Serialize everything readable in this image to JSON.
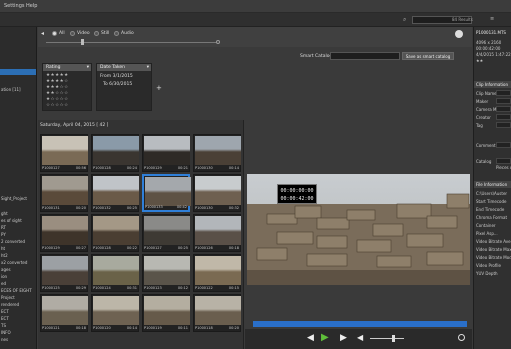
{
  "menubar": {
    "items": [
      "Settings",
      "Help"
    ]
  },
  "search": {
    "results_label": "84 Results"
  },
  "sidebar": {
    "items": [
      {
        "label": "",
        "selected": true
      },
      {
        "label": "ation [11]",
        "selected": false
      },
      {
        "label": "Sight_Project",
        "selected": false
      },
      {
        "label": "ght",
        "selected": false
      },
      {
        "label": "es of sight",
        "selected": false
      },
      {
        "label": "RT",
        "selected": false
      },
      {
        "label": "PY",
        "selected": false
      },
      {
        "label": "2 converted",
        "selected": false
      },
      {
        "label": "ht",
        "selected": false
      },
      {
        "label": "ht2",
        "selected": false
      },
      {
        "label": "x2 converted",
        "selected": false
      },
      {
        "label": "ages",
        "selected": false
      },
      {
        "label": "ion",
        "selected": false
      },
      {
        "label": "ed",
        "selected": false
      },
      {
        "label": "ECES OF EIGHT",
        "selected": false
      },
      {
        "label": "Project",
        "selected": false
      },
      {
        "label": "rendered",
        "selected": false
      },
      {
        "label": "ECT",
        "selected": false
      },
      {
        "label": "ECT",
        "selected": false
      },
      {
        "label": "TS",
        "selected": false
      },
      {
        "label": "INFO",
        "selected": false
      },
      {
        "label": "nes",
        "selected": false
      }
    ]
  },
  "filterbar": {
    "radios": [
      {
        "label": "All",
        "on": true
      },
      {
        "label": "Video",
        "on": false
      },
      {
        "label": "Still",
        "on": false
      },
      {
        "label": "Audio",
        "on": false
      }
    ]
  },
  "filters": {
    "rating": {
      "title": "Rating",
      "rows": [
        "★★★★★",
        "★★★★☆",
        "★★★☆☆",
        "★★☆☆☆",
        "★☆☆☆☆",
        "☆☆☆☆☆"
      ]
    },
    "date": {
      "title": "Date Taken",
      "from": "From 3/1/2015",
      "to": "To 6/30/2015"
    },
    "smart_catalog_label": "Smart Catalog",
    "save_label": "Save as smart catalog",
    "add_symbol": "+"
  },
  "grid": {
    "date_header": "Saturday, April 04, 2015 [ 42 ]",
    "thumbs": [
      {
        "name": "P1000127",
        "tc": "00:56",
        "colors": [
          "#c8c2b6",
          "#7a6a55"
        ]
      },
      {
        "name": "P1000128",
        "tc": "00:24",
        "colors": [
          "#8a9aa8",
          "#3a3530"
        ]
      },
      {
        "name": "P1000129",
        "tc": "00:21",
        "colors": [
          "#b8bcc0",
          "#2e2a26"
        ]
      },
      {
        "name": "P1000130",
        "tc": "00:14",
        "colors": [
          "#9ea6ae",
          "#4a4036"
        ]
      },
      {
        "name": "P1000131",
        "tc": "00:20",
        "colors": [
          "#a09a90",
          "#5a4a3a"
        ]
      },
      {
        "name": "P1000132",
        "tc": "00:25",
        "colors": [
          "#c0c4c8",
          "#6a5a48"
        ]
      },
      {
        "name": "P1000133",
        "tc": "00:42",
        "colors": [
          "#a4a8ac",
          "#5e5244"
        ],
        "selected": true
      },
      {
        "name": "P1000130",
        "tc": "00:32",
        "colors": [
          "#c8ccce",
          "#6e6050"
        ]
      },
      {
        "name": "P1000129",
        "tc": "00:27",
        "colors": [
          "#9a8e80",
          "#3e342a"
        ]
      },
      {
        "name": "P1000128",
        "tc": "00:22",
        "colors": [
          "#a49886",
          "#4a3e32"
        ]
      },
      {
        "name": "P1000127",
        "tc": "00:25",
        "colors": [
          "#8a8a88",
          "#3e3a34"
        ]
      },
      {
        "name": "P1000126",
        "tc": "00:18",
        "colors": [
          "#b2b6ba",
          "#5a5048"
        ]
      },
      {
        "name": "P1000125",
        "tc": "00:29",
        "colors": [
          "#9ca0a4",
          "#4a4038"
        ]
      },
      {
        "name": "P1000124",
        "tc": "00:31",
        "colors": [
          "#a8aa9e",
          "#6a6248"
        ]
      },
      {
        "name": "P1000123",
        "tc": "00:12",
        "colors": [
          "#b8b8b2",
          "#5a544a"
        ]
      },
      {
        "name": "P1000122",
        "tc": "00:15",
        "colors": [
          "#c0b8a8",
          "#7a6a52"
        ]
      },
      {
        "name": "P1000121",
        "tc": "00:18",
        "colors": [
          "#b0aca4",
          "#6a6050"
        ]
      },
      {
        "name": "P1000120",
        "tc": "00:14",
        "colors": [
          "#bcb6a8",
          "#6e6252"
        ]
      },
      {
        "name": "P1000119",
        "tc": "00:11",
        "colors": [
          "#b4aea0",
          "#665a4a"
        ]
      },
      {
        "name": "P1000118",
        "tc": "00:20",
        "colors": [
          "#b8b2a6",
          "#6a5e4e"
        ]
      }
    ]
  },
  "viewer": {
    "timecode_top": "00:00:00:00",
    "timecode_bottom": "00:00:42:00"
  },
  "rpanel": {
    "title": "P1000131.MTS",
    "dims": "4096 x 2160",
    "time": "00:00:42:00",
    "date": "4/4/2015 1:47:22 PM",
    "sections": {
      "clip_info": "Clip Information",
      "file_info": "File Information"
    },
    "fields": [
      "Clip Name",
      "Maker",
      "Camera Model",
      "Creator",
      "Tag",
      "Comment",
      "Catalog"
    ],
    "file_fields": [
      "C:\\Users\\Auster",
      "Start Timecode",
      "End Timecode",
      "Chroma Format",
      "Container",
      "Pixel Asp...",
      "Video Bitrate Avera...",
      "Video Bitrate Max",
      "Video Bitrate Mode",
      "Video Profile",
      "YUV Depth"
    ],
    "catalog_value": "Pieces of..."
  },
  "colors": {
    "accent": "#2f7fd8",
    "selection": "#2c6fb5",
    "play": "#5fbf3a"
  }
}
